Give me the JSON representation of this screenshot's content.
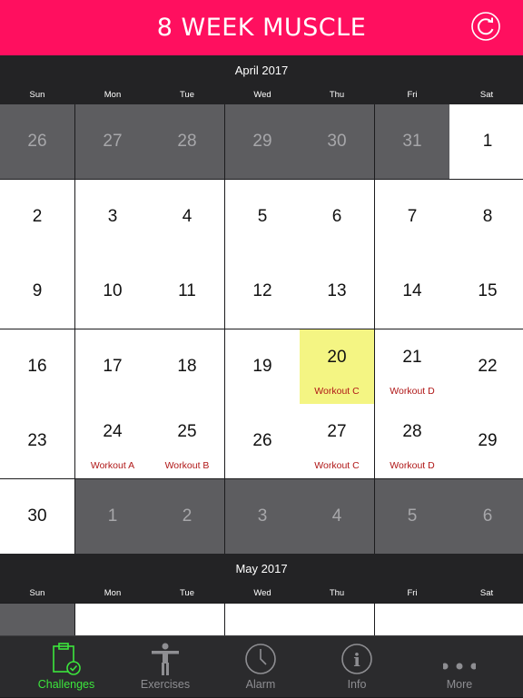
{
  "app": {
    "title": "8 WEEK MUSCLE"
  },
  "weekdays": [
    "Sun",
    "Mon",
    "Tue",
    "Wed",
    "Thu",
    "Fri",
    "Sat"
  ],
  "months": [
    {
      "title": "April 2017",
      "weeks": [
        [
          {
            "day": "26",
            "other": true
          },
          {
            "day": "27",
            "other": true
          },
          {
            "day": "28",
            "other": true
          },
          {
            "day": "29",
            "other": true
          },
          {
            "day": "30",
            "other": true
          },
          {
            "day": "31",
            "other": true
          },
          {
            "day": "1"
          }
        ],
        [
          {
            "day": "2"
          },
          {
            "day": "3"
          },
          {
            "day": "4"
          },
          {
            "day": "5"
          },
          {
            "day": "6"
          },
          {
            "day": "7"
          },
          {
            "day": "8"
          }
        ],
        [
          {
            "day": "9"
          },
          {
            "day": "10"
          },
          {
            "day": "11"
          },
          {
            "day": "12"
          },
          {
            "day": "13"
          },
          {
            "day": "14"
          },
          {
            "day": "15"
          }
        ],
        [
          {
            "day": "16"
          },
          {
            "day": "17"
          },
          {
            "day": "18"
          },
          {
            "day": "19"
          },
          {
            "day": "20",
            "today": true,
            "event": "Workout C"
          },
          {
            "day": "21",
            "event": "Workout D"
          },
          {
            "day": "22"
          }
        ],
        [
          {
            "day": "23"
          },
          {
            "day": "24",
            "event": "Workout A"
          },
          {
            "day": "25",
            "event": "Workout B"
          },
          {
            "day": "26"
          },
          {
            "day": "27",
            "event": "Workout C"
          },
          {
            "day": "28",
            "event": "Workout D"
          },
          {
            "day": "29"
          }
        ],
        [
          {
            "day": "30"
          },
          {
            "day": "1",
            "other": true
          },
          {
            "day": "2",
            "other": true
          },
          {
            "day": "3",
            "other": true
          },
          {
            "day": "4",
            "other": true
          },
          {
            "day": "5",
            "other": true
          },
          {
            "day": "6",
            "other": true
          }
        ]
      ]
    },
    {
      "title": "May 2017",
      "weeks": [
        [
          {
            "day": "",
            "other": true
          },
          {
            "day": ""
          },
          {
            "day": ""
          },
          {
            "day": ""
          },
          {
            "day": ""
          },
          {
            "day": ""
          },
          {
            "day": ""
          }
        ]
      ]
    }
  ],
  "tabs": [
    {
      "label": "Challenges",
      "icon": "clipboard-check-icon",
      "active": true
    },
    {
      "label": "Exercises",
      "icon": "person-icon",
      "active": false
    },
    {
      "label": "Alarm",
      "icon": "clock-icon",
      "active": false
    },
    {
      "label": "Info",
      "icon": "info-icon",
      "active": false
    },
    {
      "label": "More",
      "icon": "more-dots-icon",
      "active": false
    }
  ],
  "colors": {
    "header": "#ff0f5f",
    "event_text": "#b01717",
    "today": "#f4f583",
    "active_tab": "#3ce63c"
  }
}
